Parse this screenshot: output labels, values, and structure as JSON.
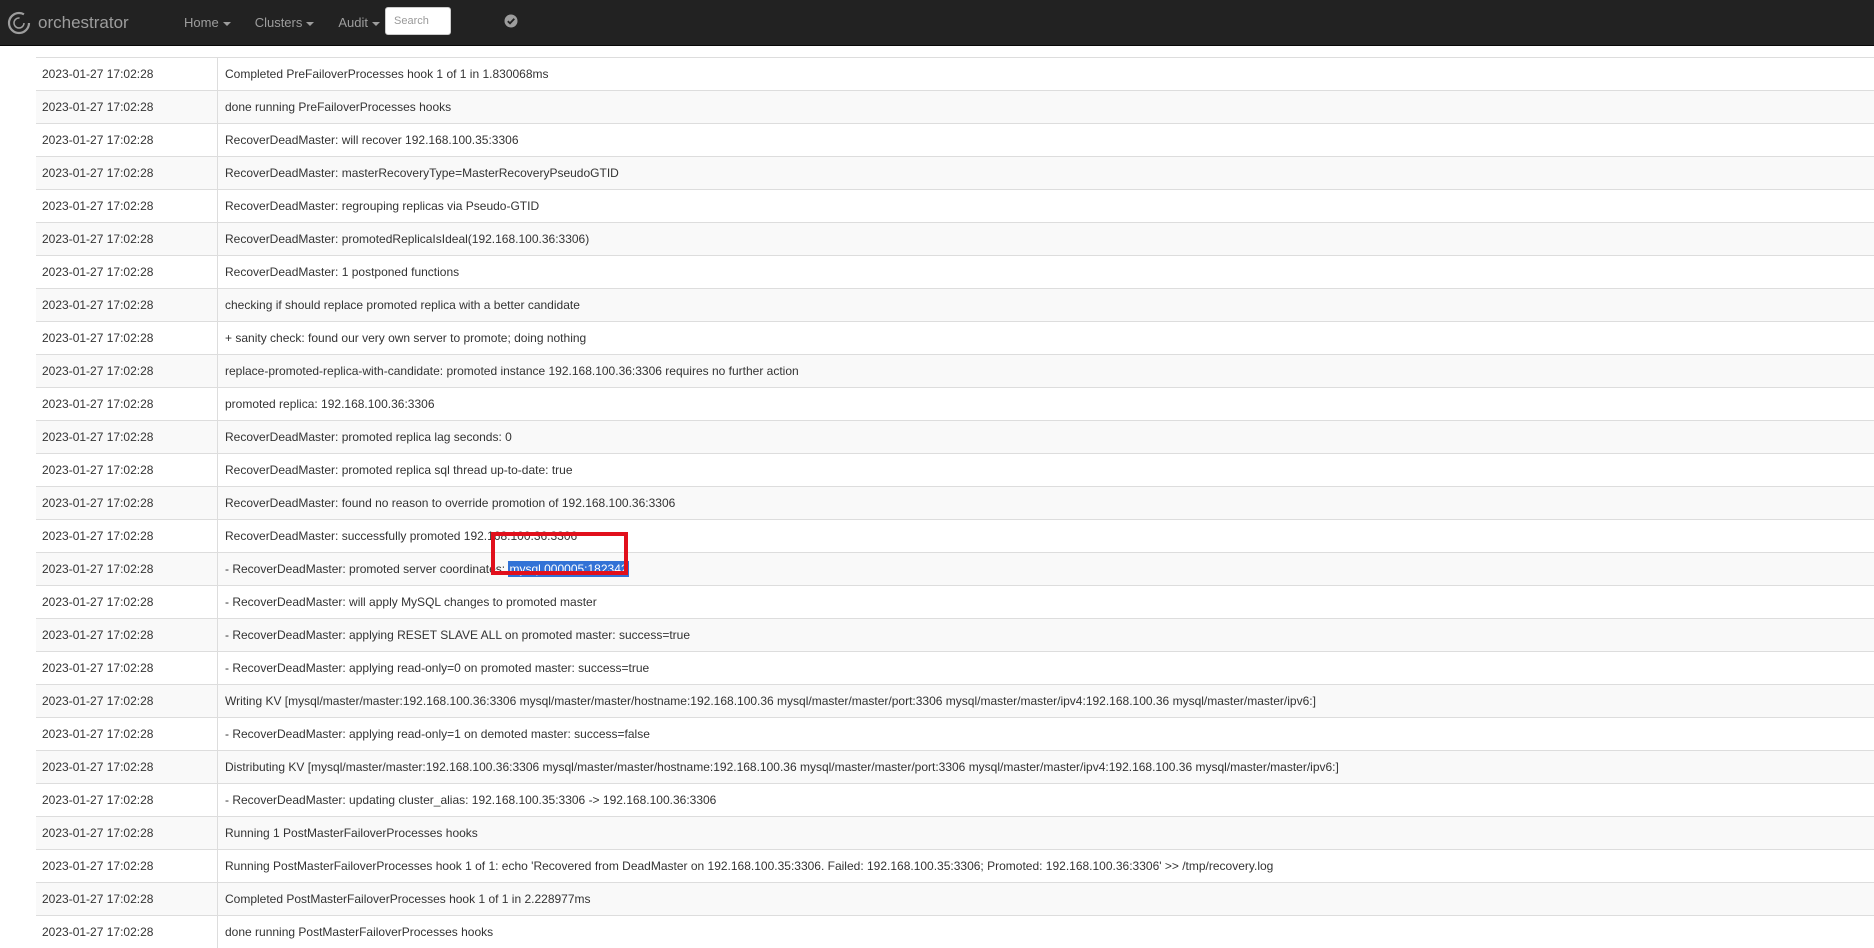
{
  "navbar": {
    "brand": "orchestrator",
    "menu": [
      "Home",
      "Clusters",
      "Audit"
    ],
    "search_placeholder": "Search",
    "icons": [
      "orchestrator-logo-icon",
      "check-circle-icon"
    ]
  },
  "log": {
    "rows": [
      {
        "time": "2023-01-27 17:02:28",
        "message": "Completed PreFailoverProcesses hook 1 of 1 in 1.830068ms"
      },
      {
        "time": "2023-01-27 17:02:28",
        "message": "done running PreFailoverProcesses hooks"
      },
      {
        "time": "2023-01-27 17:02:28",
        "message": "RecoverDeadMaster: will recover 192.168.100.35:3306"
      },
      {
        "time": "2023-01-27 17:02:28",
        "message": "RecoverDeadMaster: masterRecoveryType=MasterRecoveryPseudoGTID"
      },
      {
        "time": "2023-01-27 17:02:28",
        "message": "RecoverDeadMaster: regrouping replicas via Pseudo-GTID"
      },
      {
        "time": "2023-01-27 17:02:28",
        "message": "RecoverDeadMaster: promotedReplicaIsIdeal(192.168.100.36:3306)"
      },
      {
        "time": "2023-01-27 17:02:28",
        "message": "RecoverDeadMaster: 1 postponed functions"
      },
      {
        "time": "2023-01-27 17:02:28",
        "message": "checking if should replace promoted replica with a better candidate"
      },
      {
        "time": "2023-01-27 17:02:28",
        "message": "+ sanity check: found our very own server to promote; doing nothing"
      },
      {
        "time": "2023-01-27 17:02:28",
        "message": "replace-promoted-replica-with-candidate: promoted instance 192.168.100.36:3306 requires no further action"
      },
      {
        "time": "2023-01-27 17:02:28",
        "message": "promoted replica: 192.168.100.36:3306"
      },
      {
        "time": "2023-01-27 17:02:28",
        "message": "RecoverDeadMaster: promoted replica lag seconds: 0"
      },
      {
        "time": "2023-01-27 17:02:28",
        "message": "RecoverDeadMaster: promoted replica sql thread up-to-date: true"
      },
      {
        "time": "2023-01-27 17:02:28",
        "message": "RecoverDeadMaster: found no reason to override promotion of 192.168.100.36:3306"
      },
      {
        "time": "2023-01-27 17:02:28",
        "message": "RecoverDeadMaster: successfully promoted 192.168.100.36:3306"
      },
      {
        "time": "2023-01-27 17:02:28",
        "message": "- RecoverDeadMaster: promoted server coordinates: ",
        "selected": "mysql.000005:182342"
      },
      {
        "time": "2023-01-27 17:02:28",
        "message": "- RecoverDeadMaster: will apply MySQL changes to promoted master"
      },
      {
        "time": "2023-01-27 17:02:28",
        "message": "- RecoverDeadMaster: applying RESET SLAVE ALL on promoted master: success=true"
      },
      {
        "time": "2023-01-27 17:02:28",
        "message": "- RecoverDeadMaster: applying read-only=0 on promoted master: success=true"
      },
      {
        "time": "2023-01-27 17:02:28",
        "message": "Writing KV [mysql/master/master:192.168.100.36:3306 mysql/master/master/hostname:192.168.100.36 mysql/master/master/port:3306 mysql/master/master/ipv4:192.168.100.36 mysql/master/master/ipv6:]"
      },
      {
        "time": "2023-01-27 17:02:28",
        "message": "- RecoverDeadMaster: applying read-only=1 on demoted master: success=false"
      },
      {
        "time": "2023-01-27 17:02:28",
        "message": "Distributing KV [mysql/master/master:192.168.100.36:3306 mysql/master/master/hostname:192.168.100.36 mysql/master/master/port:3306 mysql/master/master/ipv4:192.168.100.36 mysql/master/master/ipv6:]"
      },
      {
        "time": "2023-01-27 17:02:28",
        "message": "- RecoverDeadMaster: updating cluster_alias: 192.168.100.35:3306 -> 192.168.100.36:3306"
      },
      {
        "time": "2023-01-27 17:02:28",
        "message": "Running 1 PostMasterFailoverProcesses hooks"
      },
      {
        "time": "2023-01-27 17:02:28",
        "message": "Running PostMasterFailoverProcesses hook 1 of 1: echo 'Recovered from DeadMaster on 192.168.100.35:3306. Failed: 192.168.100.35:3306; Promoted: 192.168.100.36:3306' >> /tmp/recovery.log"
      },
      {
        "time": "2023-01-27 17:02:28",
        "message": "Completed PostMasterFailoverProcesses hook 1 of 1 in 2.228977ms"
      },
      {
        "time": "2023-01-27 17:02:28",
        "message": "done running PostMasterFailoverProcesses hooks"
      }
    ]
  },
  "annotation": {
    "color": "#e1101c"
  }
}
